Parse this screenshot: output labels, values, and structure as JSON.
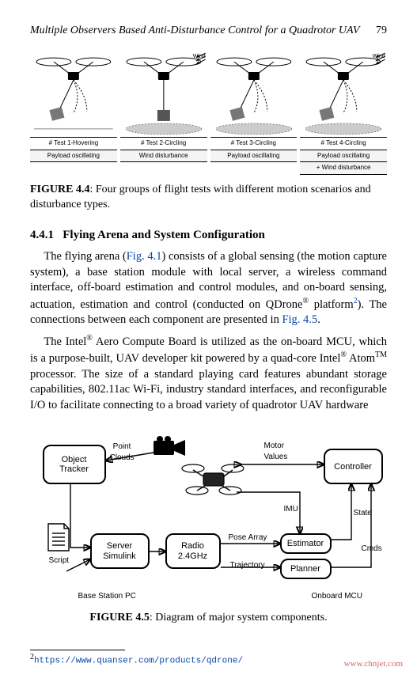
{
  "running_head": {
    "title": "Multiple Observers Based Anti-Disturbance Control for a Quadrotor UAV",
    "page": "79"
  },
  "fig44": {
    "panels": [
      {
        "title": "# Test 1-Hovering",
        "subs": [
          "Payload oscillating"
        ],
        "wind": false,
        "disc": false
      },
      {
        "title": "# Test 2-Circling",
        "subs": [
          "Wind disturbance"
        ],
        "wind": true,
        "disc": true
      },
      {
        "title": "# Test 3-Circling",
        "subs": [
          "Payload oscillating"
        ],
        "wind": false,
        "disc": true
      },
      {
        "title": "# Test 4-Circling",
        "subs": [
          "Payload oscillating",
          "+ Wind disturbance"
        ],
        "wind": true,
        "disc": true
      }
    ],
    "label": "FIGURE 4.4",
    "caption": ": Four groups of flight tests with different motion scenarios and disturbance types."
  },
  "section": {
    "num": "4.4.1",
    "title": "Flying Arena and System Configuration"
  },
  "para1": {
    "lead": "The flying arena (",
    "fig_ref": "Fig. 4.1",
    "mid1": ") consists of a global sensing (the motion capture system), a base station module with local server, a wireless command interface, off-board estimation and control modules, and on-board sensing, actuation, estimation and control (conducted on QDrone",
    "reg1": "®",
    "mid2": " platform",
    "fn": "2",
    "mid3": "). The connections between each component are presented in ",
    "fig_ref2": "Fig. 4.5",
    "tail": "."
  },
  "para2": {
    "t1": "The Intel",
    "reg1": "®",
    "t2": " Aero Compute Board is utilized as the on-board MCU, which is a purpose-built, UAV developer kit powered by a quad-core Intel",
    "reg2": "®",
    "t3": " Atom",
    "tm": "TM",
    "t4": " processor. The size of a standard playing card features abundant storage capabilities, 802.11ac Wi-Fi, industry standard interfaces, and reconfigurable I/O to facilitate connecting to a broad variety of quadrotor UAV hardware"
  },
  "fig45": {
    "boxes": {
      "object_tracker": "Object\nTracker",
      "server_simulink": "Server\nSimulink",
      "radio": "Radio\n2.4GHz",
      "controller": "Controller",
      "estimator": "Estimator",
      "planner": "Planner"
    },
    "labels": {
      "point_clouds": "Point\nClouds",
      "motor_values": "Motor\nValues",
      "imu": "IMU",
      "state": "State",
      "cmds": "Cmds",
      "pose_array": "Pose Array",
      "trajectory": "Trajectory",
      "script": "Script",
      "base_pc": "Base Station PC",
      "onboard": "Onboard MCU"
    },
    "label": "FIGURE 4.5",
    "caption": ": Diagram of major system components."
  },
  "footnote": {
    "marker": "2",
    "url": "https://www.quanser.com/products/qdrone/"
  },
  "watermark": "www.chnjet.com"
}
